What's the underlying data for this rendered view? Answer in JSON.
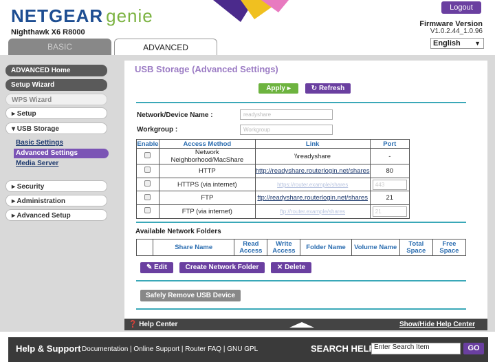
{
  "header": {
    "brand": "NETGEAR",
    "genie": "genie",
    "model": "Nighthawk X6 R8000",
    "logout": "Logout",
    "firmware_label": "Firmware Version",
    "firmware_value": "V1.0.2.44_1.0.96",
    "language": "English"
  },
  "tabs": {
    "basic": "BASIC",
    "advanced": "ADVANCED"
  },
  "sidebar": {
    "advanced_home": "ADVANCED Home",
    "setup_wizard": "Setup Wizard",
    "wps_wizard": "WPS Wizard",
    "setup": "▸ Setup",
    "usb_storage": "▾ USB Storage",
    "basic_settings": "Basic Settings",
    "advanced_settings": "Advanced Settings",
    "media_server": "Media Server",
    "security": "▸ Security",
    "administration": "▸ Administration",
    "advanced_setup": "▸ Advanced Setup"
  },
  "main": {
    "title": "USB Storage (Advanced Settings)",
    "apply": "Apply ▸",
    "refresh": "↻ Refresh",
    "device_name_label": "Network/Device Name :",
    "device_name_value": "readyshare",
    "workgroup_label": "Workgroup :",
    "workgroup_value": "Workgroup",
    "access_table": {
      "headers": [
        "Enable",
        "Access Method",
        "Link",
        "Port"
      ],
      "rows": [
        {
          "method": "Network Neighborhood/MacShare",
          "link": "\\\\readyshare",
          "port": "-"
        },
        {
          "method": "HTTP",
          "link": "http://readyshare.routerlogin.net/shares",
          "port": "80"
        },
        {
          "method": "HTTPS (via internet)",
          "link": "https://router.example/shares",
          "port": "443"
        },
        {
          "method": "FTP",
          "link": "ftp://readyshare.routerlogin.net/shares",
          "port": "21"
        },
        {
          "method": "FTP (via internet)",
          "link": "ftp://router.example/shares",
          "port": "21"
        }
      ]
    },
    "folders_title": "Available Network Folders",
    "folders_headers": [
      "",
      "Share Name",
      "Read Access",
      "Write Access",
      "Folder Name",
      "Volume Name",
      "Total Space",
      "Free Space"
    ],
    "edit": "✎ Edit",
    "create": "Create Network Folder",
    "delete": "✕ Delete",
    "safely_remove": "Safely Remove USB Device"
  },
  "helpbar": {
    "help_center": "❓ Help Center",
    "show_hide": "Show/Hide Help Center"
  },
  "footer": {
    "title": "Help & Support",
    "links": "Documentation | Online Support | Router FAQ | GNU GPL",
    "search_label": "SEARCH HELP",
    "search_value": "Enter Search Item",
    "go": "GO"
  }
}
